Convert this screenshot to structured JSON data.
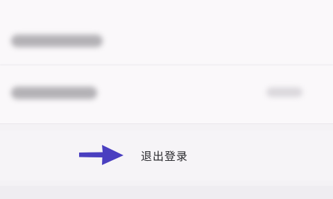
{
  "settings": {
    "logout_label": "退出登录"
  },
  "icons": {
    "pointer": "arrow-right-icon"
  },
  "colors": {
    "arrow": "#4a3fc0",
    "background": "#f4f2f5",
    "text": "#2a2a2e"
  }
}
